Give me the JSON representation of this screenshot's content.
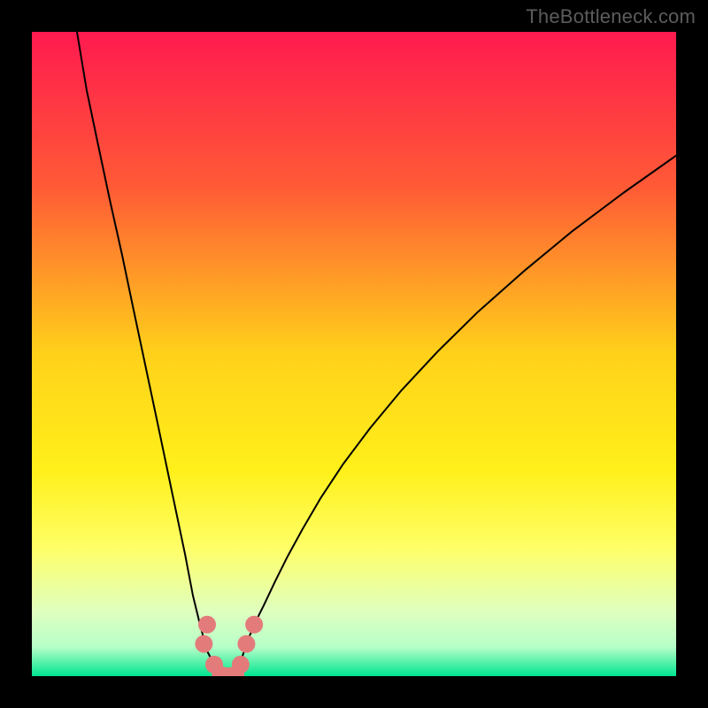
{
  "watermark": "TheBottleneck.com",
  "chart_data": {
    "type": "line",
    "title": "",
    "xlabel": "",
    "ylabel": "",
    "xlim": [
      0,
      100
    ],
    "ylim": [
      0,
      100
    ],
    "grid": false,
    "legend": false,
    "background_gradient_stops": [
      {
        "offset": 0,
        "color": "#ff1a4f"
      },
      {
        "offset": 0.24,
        "color": "#ff5a36"
      },
      {
        "offset": 0.5,
        "color": "#ffd11a"
      },
      {
        "offset": 0.68,
        "color": "#fff01a"
      },
      {
        "offset": 0.8,
        "color": "#ffff66"
      },
      {
        "offset": 0.9,
        "color": "#dfffbf"
      },
      {
        "offset": 0.955,
        "color": "#b6ffc8"
      },
      {
        "offset": 1.0,
        "color": "#00e58f"
      }
    ],
    "series": [
      {
        "name": "bottleneck-curve",
        "color": "#000000",
        "stroke_width": 2,
        "x": [
          7.0,
          8.5,
          10.3,
          12.1,
          14.0,
          15.8,
          17.6,
          19.4,
          21.2,
          22.5,
          23.8,
          25.0,
          26.1,
          27.2,
          28.3,
          29.4,
          30.5,
          31.6,
          32.5,
          33.3,
          34.5,
          36.0,
          37.8,
          39.7,
          42.0,
          44.8,
          48.3,
          52.5,
          57.4,
          63.0,
          69.3,
          76.3,
          83.8,
          91.8,
          100.0
        ],
        "y": [
          100.0,
          91.0,
          82.4,
          73.9,
          65.4,
          56.8,
          48.3,
          39.8,
          31.2,
          25.0,
          18.8,
          12.5,
          8.0,
          3.9,
          1.8,
          0.0,
          0.0,
          0.0,
          2.5,
          5.0,
          8.0,
          11.0,
          14.8,
          18.6,
          22.8,
          27.6,
          32.9,
          38.5,
          44.4,
          50.4,
          56.6,
          62.8,
          69.0,
          75.0,
          80.8
        ]
      }
    ],
    "scatter_points": {
      "name": "highlight-dots",
      "color": "#e47b7b",
      "radius": 10,
      "points": [
        {
          "x": 26.7,
          "y": 5.0
        },
        {
          "x": 27.2,
          "y": 8.0
        },
        {
          "x": 28.3,
          "y": 1.8
        },
        {
          "x": 29.3,
          "y": 0.2
        },
        {
          "x": 30.2,
          "y": 0.0
        },
        {
          "x": 30.8,
          "y": 0.0
        },
        {
          "x": 31.6,
          "y": 0.2
        },
        {
          "x": 32.4,
          "y": 1.8
        },
        {
          "x": 33.3,
          "y": 5.0
        },
        {
          "x": 34.5,
          "y": 8.0
        }
      ]
    }
  }
}
